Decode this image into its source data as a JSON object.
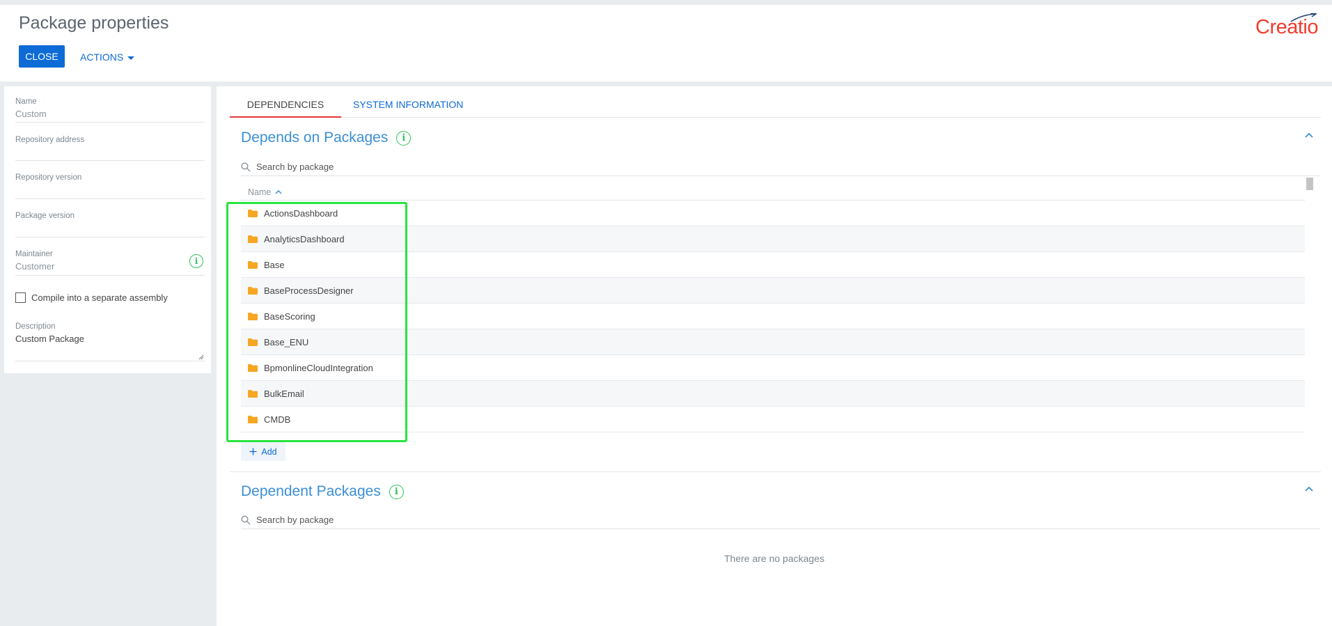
{
  "header": {
    "title": "Package properties",
    "close_label": "CLOSE",
    "actions_label": "ACTIONS",
    "logo_text": "Creatio"
  },
  "properties": {
    "name_label": "Name",
    "name_value": "Custom",
    "repo_address_label": "Repository address",
    "repo_address_value": "",
    "repo_version_label": "Repository version",
    "repo_version_value": "",
    "package_version_label": "Package version",
    "package_version_value": "",
    "maintainer_label": "Maintainer",
    "maintainer_value": "Customer",
    "compile_label": "Compile into a separate assembly",
    "compile_checked": false,
    "description_label": "Description",
    "description_value": "Custom Package"
  },
  "tabs": [
    {
      "label": "DEPENDENCIES",
      "active": true
    },
    {
      "label": "SYSTEM INFORMATION",
      "active": false
    }
  ],
  "depends_on": {
    "title": "Depends on Packages",
    "search_placeholder": "Search by package",
    "column_name": "Name",
    "sort": "ascending",
    "packages": [
      "ActionsDashboard",
      "AnalyticsDashboard",
      "Base",
      "BaseProcessDesigner",
      "BaseScoring",
      "Base_ENU",
      "BpmonlineCloudIntegration",
      "BulkEmail",
      "CMDB"
    ],
    "add_label": "Add"
  },
  "dependent": {
    "title": "Dependent Packages",
    "search_placeholder": "Search by package",
    "empty_text": "There are no packages"
  },
  "colors": {
    "accent": "#0d6bd6",
    "section_title": "#3b8fd6",
    "info": "#2ec15a",
    "folder": "#f5a623",
    "highlight": "#27e53f",
    "logo": "#ef3d2d"
  }
}
